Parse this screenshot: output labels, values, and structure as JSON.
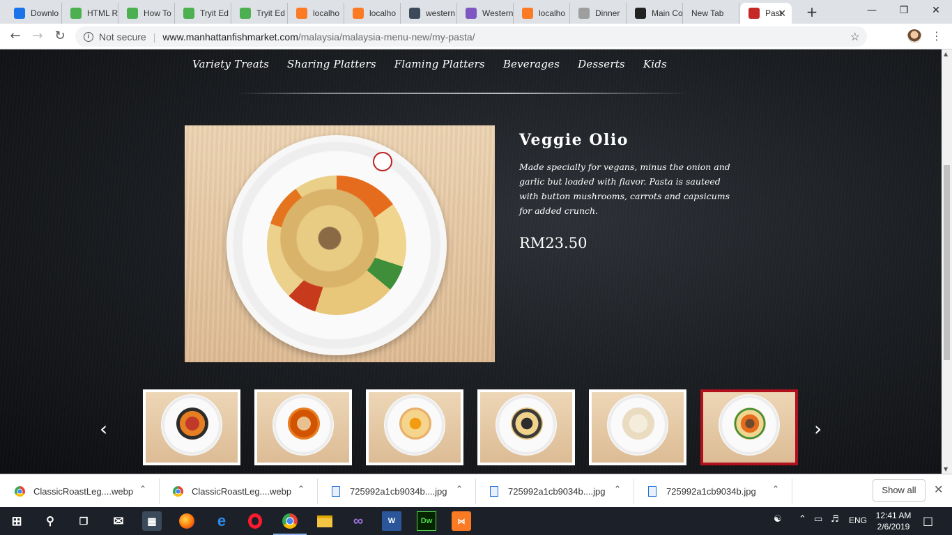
{
  "browser": {
    "tabs": [
      {
        "title": "Downlo",
        "icon": "download-icon",
        "color": "#1a73e8"
      },
      {
        "title": "HTML R",
        "icon": "w3schools-icon",
        "color": "#4caf50"
      },
      {
        "title": "How To",
        "icon": "w3schools-icon",
        "color": "#4caf50"
      },
      {
        "title": "Tryit Ed",
        "icon": "w3schools-icon",
        "color": "#4caf50"
      },
      {
        "title": "Tryit Ed",
        "icon": "w3schools-icon",
        "color": "#4caf50"
      },
      {
        "title": "localho",
        "icon": "xampp-icon",
        "color": "#fb7a24"
      },
      {
        "title": "localho",
        "icon": "xampp-icon",
        "color": "#fb7a24"
      },
      {
        "title": "western",
        "icon": "image-site-icon",
        "color": "#3c4a5c"
      },
      {
        "title": "Western",
        "icon": "gemini-icon",
        "color": "#7e57c2"
      },
      {
        "title": "localho",
        "icon": "xampp-icon",
        "color": "#fb7a24"
      },
      {
        "title": "Dinner",
        "icon": "broken-image-icon",
        "color": "#9e9e9e"
      },
      {
        "title": "Main Co",
        "icon": "scribd-icon",
        "color": "#222222"
      },
      {
        "title": "New Tab",
        "icon": "",
        "color": ""
      },
      {
        "title": "Past",
        "icon": "manhattan-fish-market-icon",
        "color": "#c62828"
      }
    ],
    "not_secure": "Not secure",
    "url_domain": "www.manhattanfishmarket.com",
    "url_path": "/malaysia/malaysia-menu-new/my-pasta/"
  },
  "page": {
    "categories": [
      "Variety Treats",
      "Sharing Platters",
      "Flaming Platters",
      "Beverages",
      "Desserts",
      "Kids"
    ],
    "dish": {
      "title": "Veggie Olio",
      "description": "Made specially for vegans, minus the onion and garlic but loaded with flavor. Pasta is sauteed with button mushrooms, carrots and capsicums for added crunch.",
      "price": "RM23.50"
    },
    "carousel": {
      "prev_symbol": "‹",
      "next_symbol": "›",
      "selected_index": 5,
      "thumbnails": [
        "seafood-pasta-thumbnail",
        "tomato-pasta-thumbnail",
        "shrimp-pasta-thumbnail",
        "mussel-pasta-thumbnail",
        "penne-cream-thumbnail",
        "veggie-olio-thumbnail"
      ]
    }
  },
  "downloads": {
    "items": [
      {
        "name": "ClassicRoastLeg....webp",
        "icon": "chrome-icon"
      },
      {
        "name": "ClassicRoastLeg....webp",
        "icon": "chrome-icon"
      },
      {
        "name": "725992a1cb9034b....jpg",
        "icon": "image-file-icon"
      },
      {
        "name": "725992a1cb9034b....jpg",
        "icon": "image-file-icon"
      },
      {
        "name": "725992a1cb9034b.jpg",
        "icon": "image-file-icon"
      }
    ],
    "show_all": "Show all"
  },
  "taskbar": {
    "language": "ENG",
    "time": "12:41 AM",
    "date": "2/6/2019"
  },
  "colors": {
    "accent_red": "#b3101e",
    "page_bg": "#1b1e22"
  }
}
